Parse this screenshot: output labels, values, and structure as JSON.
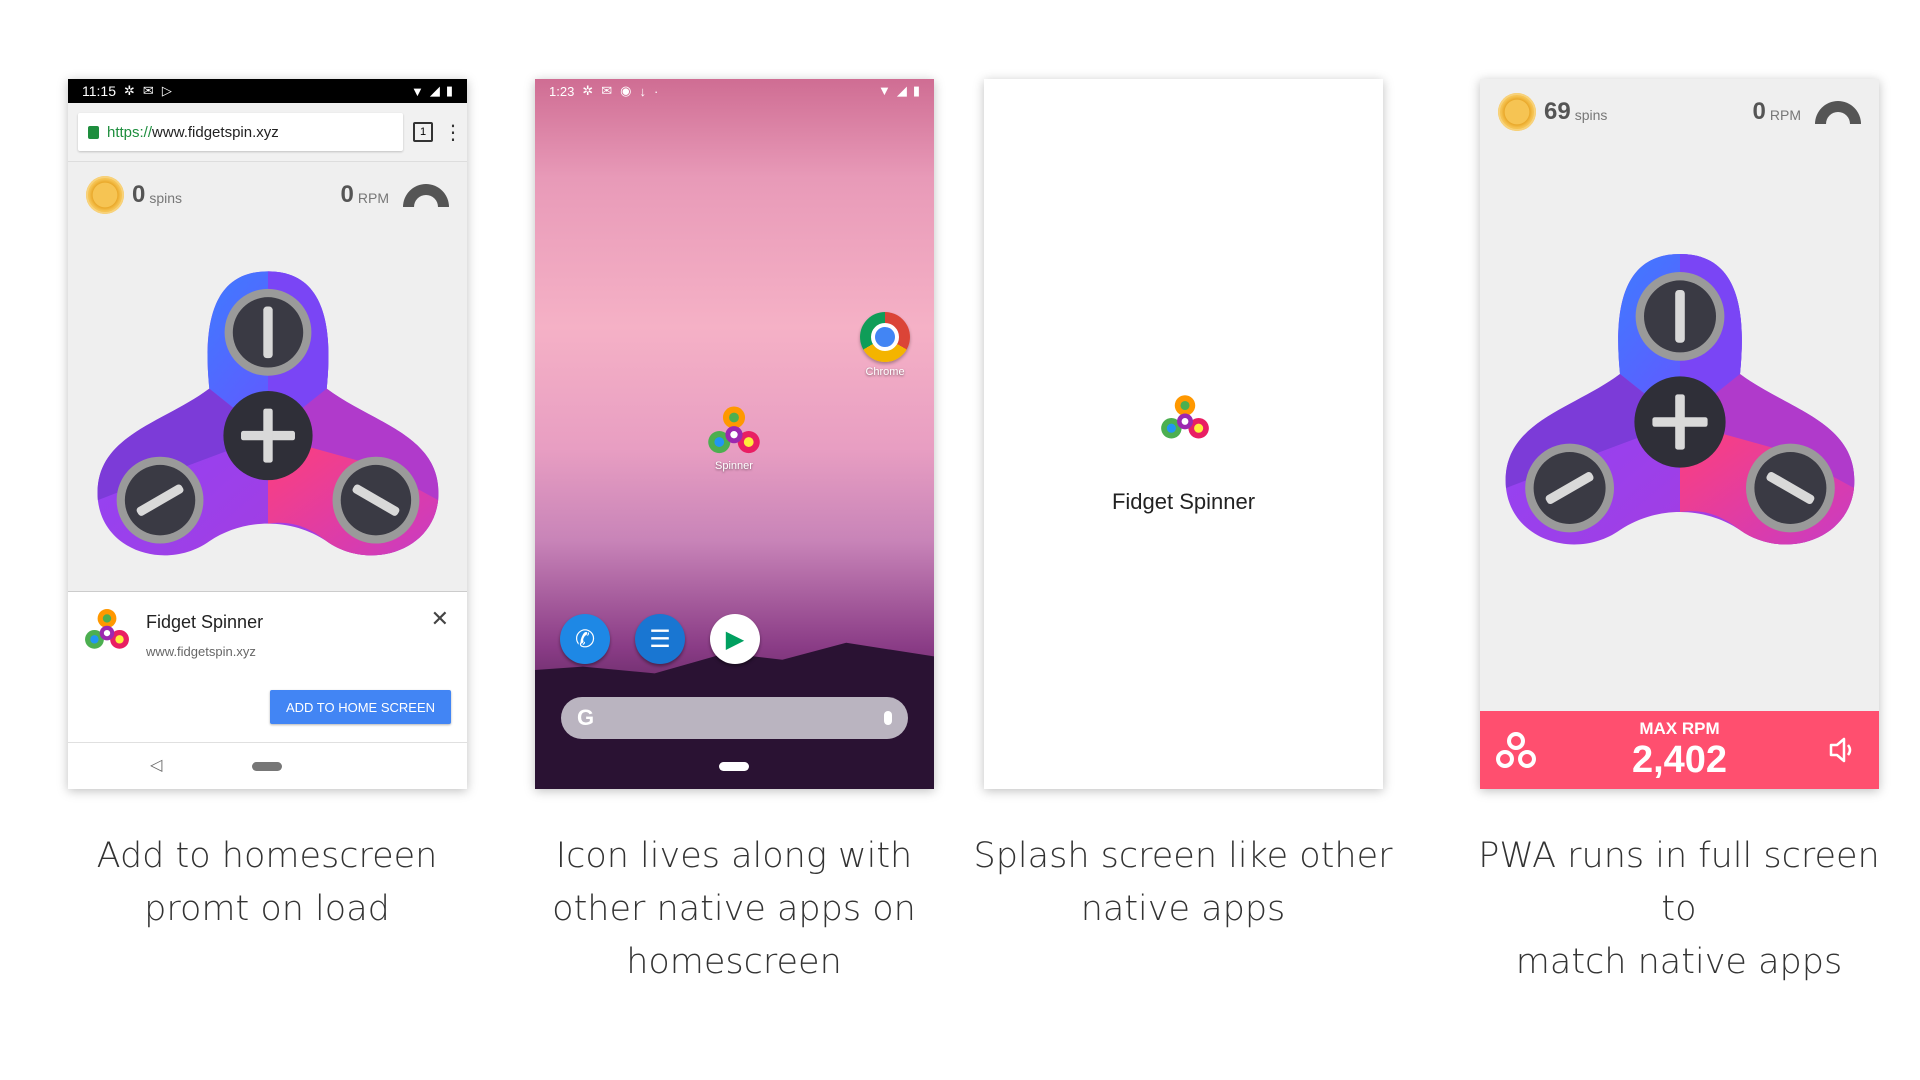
{
  "screen1": {
    "status_time": "11:15",
    "url_scheme": "https://",
    "url_host": "www.fidgetspin.xyz",
    "tab_count": "1",
    "spins_value": "0",
    "spins_unit": "spins",
    "rpm_value": "0",
    "rpm_unit": "RPM",
    "prompt_title": "Fidget Spinner",
    "prompt_url": "www.fidgetspin.xyz",
    "add_button": "ADD TO HOME SCREEN",
    "close_glyph": "✕",
    "back_glyph": "◁"
  },
  "screen2": {
    "status_time": "1:23",
    "chrome_label": "Chrome",
    "spinner_label": "Spinner",
    "search_g": "G"
  },
  "screen3": {
    "title": "Fidget Spinner"
  },
  "screen4": {
    "spins_value": "69",
    "spins_unit": "spins",
    "rpm_value": "0",
    "rpm_unit": "RPM",
    "max_label": "MAX RPM",
    "max_value": "2,402"
  },
  "captions": {
    "c1": [
      "Add to homescreen",
      "promt on load"
    ],
    "c2": [
      "Icon lives along with",
      "other native apps on",
      "homescreen"
    ],
    "c3": [
      "Splash screen like other",
      "native apps"
    ],
    "c4": [
      "PWA runs in full screen to",
      "match native apps"
    ]
  },
  "colors": {
    "accent_blue": "#4285f4",
    "bar_pink": "#ff4f6f",
    "coin_gold": "#f6c453"
  },
  "icons": [
    "settings-icon",
    "gmail-icon",
    "wifi-icon",
    "signal-icon",
    "battery-icon",
    "lock-icon",
    "tabs-icon",
    "menu-icon",
    "coin-icon",
    "gauge-icon",
    "close-icon",
    "back-icon",
    "phone-icon",
    "messages-icon",
    "play-store-icon",
    "chrome-icon",
    "mic-icon",
    "spinner-icon",
    "volume-icon"
  ]
}
